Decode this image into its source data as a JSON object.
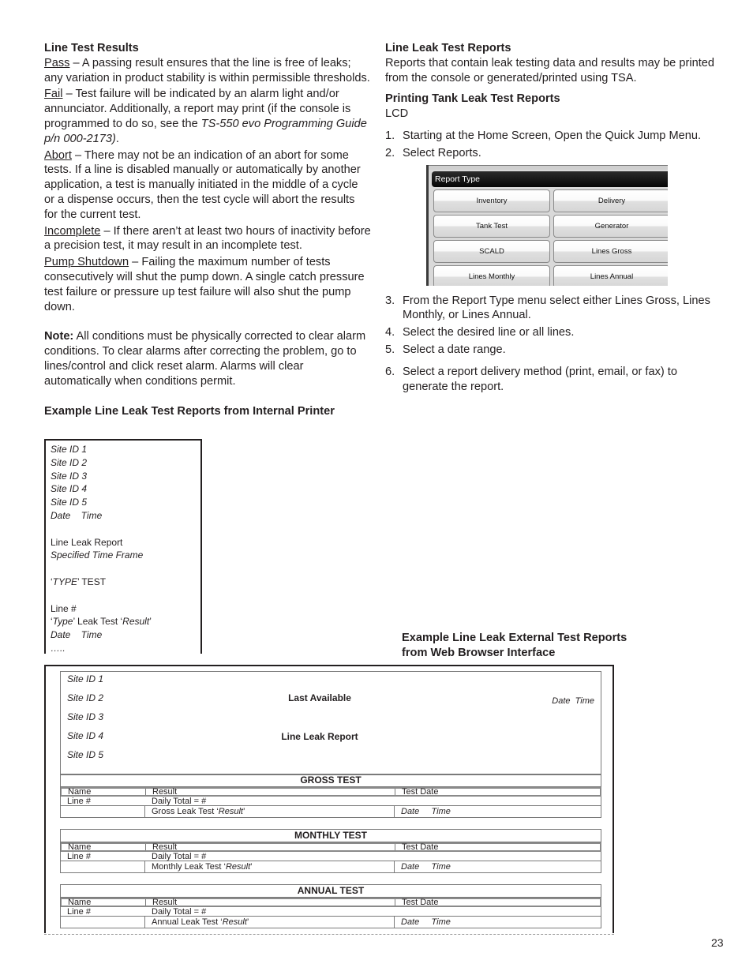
{
  "left": {
    "line_test_results": {
      "heading": "Line Test Results",
      "pass": {
        "term": "Pass",
        "text": " – A passing result ensures that the line is free of leaks; any variation in product stability is within permissible thresholds."
      },
      "fail": {
        "term": "Fail",
        "text_before": " – Test failure will be indicated by an alarm light and/or annunciator. Additionally, a report may print (if the console is programmed to do so, see the ",
        "italic_ref": "TS-550 evo Programming Guide p/n 000-2173)",
        "text_after": "."
      },
      "abort": {
        "term": "Abort",
        "text": " – There may not be an indication of an abort for some tests. If a line is disabled manually or automatically by another application, a test is manually initiated in the middle of a cycle or a dispense occurs, then the test cycle will abort the results for the current test."
      },
      "incomplete": {
        "term": "Incomplete",
        "text": " – If there aren’t at least two hours of inactivity before a precision test, it may result in an incomplete test."
      },
      "pump_shutdown": {
        "term": "Pump Shutdown",
        "text": " – Failing the maximum number of tests consecutively will shut the pump down. A single catch pressure test failure or pressure up test failure will also shut the pump down."
      }
    },
    "note": {
      "label": "Note:",
      "text": " All conditions must be physically corrected to clear alarm conditions. To clear alarms after correcting the problem, go to lines/control and click reset alarm.  Alarms will clear automatically when conditions permit."
    },
    "internal_printer_heading": "Example Line Leak Test Reports from Internal Printer"
  },
  "printer_report": {
    "site_ids": [
      "Site ID 1",
      "Site ID 2",
      "Site ID 3",
      "Site ID 4",
      "Site ID 5"
    ],
    "date_time": "Date    Time",
    "report_title": "Line Leak Report",
    "time_frame": "Specified Time Frame",
    "type_test_quote_open": "‘",
    "type_test_type": "TYPE",
    "type_test_rest": "’ TEST",
    "line_num": "Line #",
    "leak_line_q1": "‘",
    "leak_line_type": "Type",
    "leak_line_mid": "’ Leak Test ‘",
    "leak_line_result": "Result",
    "leak_line_q2": "’",
    "date_time_2": "Date    Time",
    "ellipsis": "….."
  },
  "right": {
    "line_leak_reports": {
      "heading": "Line Leak Test Reports",
      "text": "Reports that contain leak testing data and results may be printed from the console or generated/printed using TSA."
    },
    "printing_heading": "Printing Tank Leak Test Reports",
    "lcd_label": "LCD",
    "steps_a": [
      {
        "num": "1.",
        "text": "Starting at the Home Screen, Open the Quick Jump Menu."
      },
      {
        "num": "2.",
        "text": "Select Reports."
      }
    ],
    "steps_b": [
      {
        "num": "3.",
        "text": "From the Report Type menu select either Lines Gross, Lines Monthly, or Lines Annual."
      },
      {
        "num": "4.",
        "text": "Select the desired line or all lines."
      },
      {
        "num": "5.",
        "text": "Select a date range."
      }
    ],
    "steps_c": [
      {
        "num": "6.",
        "text": "Select a report delivery method (print, email, or fax) to generate the report."
      }
    ],
    "external_heading": "Example Line Leak External Test Reports from Web Browser Interface"
  },
  "lcd_screen": {
    "title": "Report Type",
    "buttons": [
      "Inventory",
      "Delivery",
      "Tank Test",
      "Generator",
      "SCALD",
      "Lines Gross",
      "Lines Monthly",
      "Lines Annual"
    ]
  },
  "web_report": {
    "site_ids": [
      "Site ID 1",
      "Site ID 2",
      "Site ID 3",
      "Site ID 4",
      "Site ID 5"
    ],
    "last_available": "Last Available",
    "report_title": "Line Leak Report",
    "date_time": "Date  Time",
    "tables": [
      {
        "title": "GROSS TEST",
        "col_name": "Name",
        "col_result": "Result",
        "col_date": "Test Date",
        "line": "Line #",
        "daily_total": "Daily Total = #",
        "leak_prefix": "Gross Leak Test ‘",
        "leak_result": "Result",
        "leak_suffix": "’",
        "date_time": "Date     Time"
      },
      {
        "title": "MONTHLY TEST",
        "col_name": "Name",
        "col_result": "Result",
        "col_date": "Test Date",
        "line": "Line #",
        "daily_total": "Daily Total = #",
        "leak_prefix": "Monthly Leak Test ‘",
        "leak_result": "Result",
        "leak_suffix": "’",
        "date_time": "Date     Time"
      },
      {
        "title": "ANNUAL TEST",
        "col_name": "Name",
        "col_result": "Result",
        "col_date": "Test Date",
        "line": "Line #",
        "daily_total": "Daily Total = #",
        "leak_prefix": "Annual Leak Test ‘",
        "leak_result": "Result",
        "leak_suffix": "’",
        "date_time": "Date     Time"
      }
    ]
  },
  "page_number": "23"
}
